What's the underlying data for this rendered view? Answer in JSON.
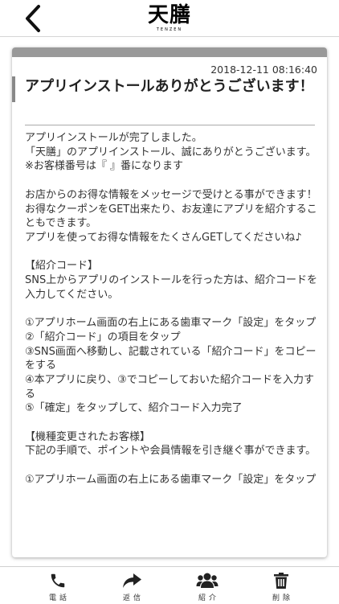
{
  "header": {
    "logo_text": "天膳",
    "logo_sub": "TENZEN",
    "back_icon": "chevron-left-icon"
  },
  "message": {
    "date": "2018-12-11 08:16:40",
    "title": "アプリインストールありがとうございます！",
    "body": "アプリインストールが完了しました。\n「天膳」のアプリインストール、誠にありがとうございます。\n※お客様番号は『 』番になります\n\nお店からのお得な情報をメッセージで受けとる事ができます！\nお得なクーポンをGET出来たり、お友達にアプリを紹介することもできます。\nアプリを使ってお得な情報をたくさんGETしてくださいね♪\n\n【紹介コード】\nSNS上からアプリのインストールを行った方は、紹介コードを入力してください。\n\n①アプリホーム画面の右上にある歯車マーク「設定」をタップ\n②「紹介コード」の項目をタップ\n③SNS画面へ移動し、記載されている「紹介コード」をコピーをする\n④本アプリに戻り、③でコピーしておいた紹介コードを入力する\n⑤「確定」をタップして、紹介コード入力完了\n\n【機種変更されたお客様】\n下記の手順で、ポイントや会員情報を引き継ぐ事ができます。\n\n①アプリホーム画面の右上にある歯車マーク「設定」をタップ"
  },
  "tabbar": {
    "items": [
      {
        "label": "電話",
        "icon": "phone-icon"
      },
      {
        "label": "返信",
        "icon": "reply-icon"
      },
      {
        "label": "紹介",
        "icon": "users-icon"
      },
      {
        "label": "削除",
        "icon": "trash-icon"
      }
    ]
  }
}
